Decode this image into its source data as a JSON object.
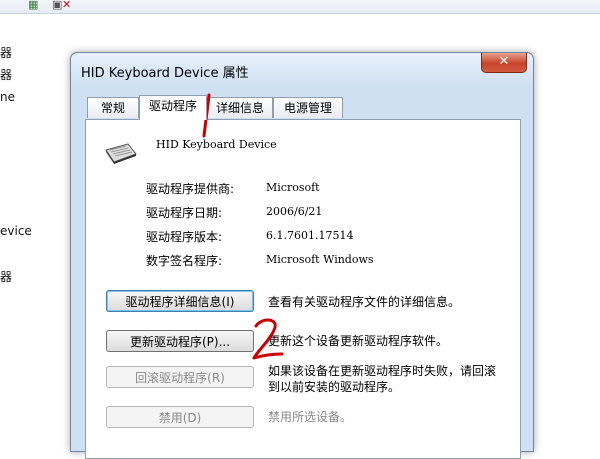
{
  "background": {
    "left_labels": [
      "器",
      "器",
      "ne",
      "evice",
      "器"
    ]
  },
  "dialog": {
    "title": "HID Keyboard Device 属性",
    "close_glyph": "✕",
    "tabs": [
      {
        "label": "常规"
      },
      {
        "label": "驱动程序"
      },
      {
        "label": "详细信息"
      },
      {
        "label": "电源管理"
      }
    ],
    "device_name": "HID Keyboard Device",
    "info": [
      {
        "label": "驱动程序提供商:",
        "value": "Microsoft"
      },
      {
        "label": "驱动程序日期:",
        "value": "2006/6/21"
      },
      {
        "label": "驱动程序版本:",
        "value": "6.1.7601.17514"
      },
      {
        "label": "数字签名程序:",
        "value": "Microsoft Windows"
      }
    ],
    "actions": [
      {
        "button": "驱动程序详细信息(I)",
        "desc": "查看有关驱动程序文件的详细信息。",
        "enabled": true
      },
      {
        "button": "更新驱动程序(P)...",
        "desc": "更新这个设备更新驱动程序软件。",
        "enabled": true
      },
      {
        "button": "回滚驱动程序(R)",
        "desc": "如果该设备在更新驱动程序时失败，请回滚到以前安装的驱动程序。",
        "enabled": false
      },
      {
        "button": "禁用(D)",
        "desc": "禁用所选设备。",
        "enabled": false
      }
    ]
  },
  "annotations": {
    "mark_1": "1",
    "mark_2": "2",
    "color": "#cc0000"
  },
  "colors": {
    "title_bar": "#cfe0f3",
    "close_button": "#c7442a",
    "disabled_text": "#8a8a8a"
  }
}
